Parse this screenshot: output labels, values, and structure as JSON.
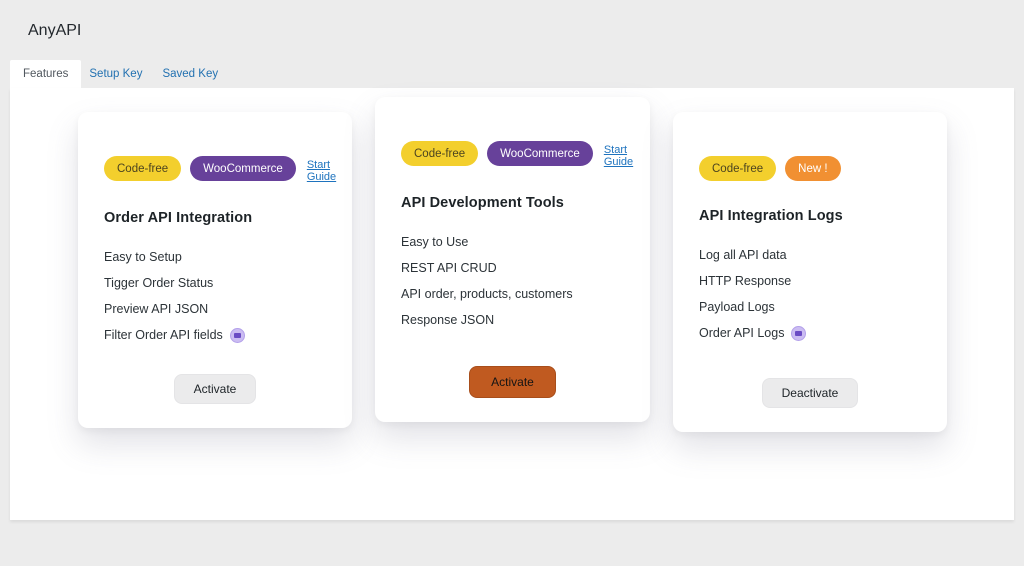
{
  "page": {
    "title": "AnyAPI"
  },
  "tabs": {
    "items": [
      {
        "label": "Features",
        "active": true
      },
      {
        "label": "Setup Key",
        "active": false
      },
      {
        "label": "Saved Key",
        "active": false
      }
    ]
  },
  "colors": {
    "page_background": "#ececec",
    "badge_yellow": "#f3cf2d",
    "badge_purple": "#67419a",
    "badge_orange": "#f19032",
    "button_orange": "#c05a20",
    "button_gray": "#ebebec",
    "link_blue": "#1e73be",
    "premium_icon_purple": "#cbbcf2"
  },
  "cards": [
    {
      "badges": [
        {
          "label": "Code-free"
        },
        {
          "label": "WooCommerce"
        }
      ],
      "link_label": "Start Guide",
      "title": "Order API Integration",
      "features": [
        "Easy to Setup",
        "Tigger Order Status",
        "Preview API JSON",
        "Filter Order API fields"
      ],
      "button_label": "Activate"
    },
    {
      "badges": [
        {
          "label": "Code-free"
        },
        {
          "label": "WooCommerce"
        }
      ],
      "link_label": "Start Guide",
      "title": "API Development Tools",
      "features": [
        "Easy to Use",
        "REST API CRUD",
        "API order, products, customers",
        "Response JSON"
      ],
      "button_label": "Activate"
    },
    {
      "badges": [
        {
          "label": "Code-free"
        },
        {
          "label": "New !"
        }
      ],
      "title": "API Integration Logs",
      "features": [
        "Log all API data",
        "HTTP Response",
        "Payload Logs",
        "Order API Logs"
      ],
      "button_label": "Deactivate"
    }
  ]
}
